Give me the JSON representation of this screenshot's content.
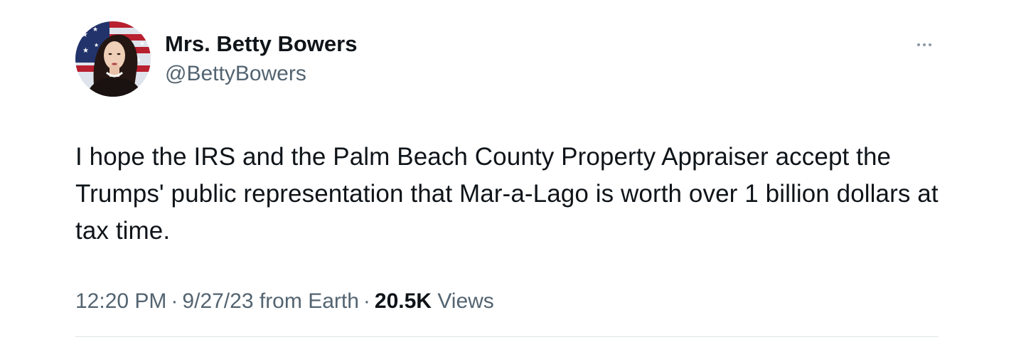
{
  "author": {
    "display_name": "Mrs. Betty Bowers",
    "handle": "@BettyBowers",
    "avatar_icon": "profile-photo"
  },
  "tweet": {
    "text": "I hope the IRS and the Palm Beach County Property Appraiser accept the Trumps' public representation that Mar-a-Lago is worth over 1 billion dollars at tax time."
  },
  "meta": {
    "time": "12:20 PM",
    "separator": "·",
    "date": "9/27/23",
    "source": "from Earth",
    "views_count": "20.5K",
    "views_label": "Views"
  },
  "icons": {
    "more": "more-horizontal-icon"
  },
  "colors": {
    "primary_text": "#0f1419",
    "secondary_text": "#536471",
    "divider": "#dfe3e7",
    "more_icon": "#8b98a5"
  }
}
